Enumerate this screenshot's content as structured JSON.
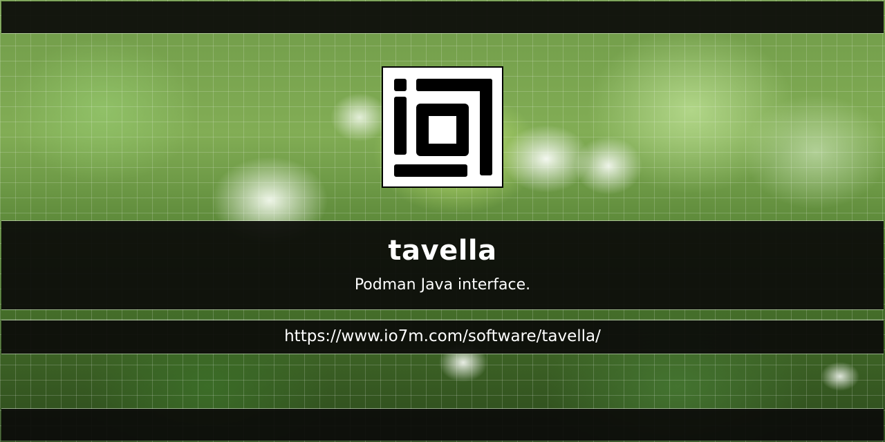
{
  "project": {
    "name": "tavella",
    "description": "Podman Java interface.",
    "url": "https://www.io7m.com/software/tavella/"
  },
  "logo": {
    "icon": "io7m-logo-icon"
  },
  "colors": {
    "bar_background": "#0c0c0a",
    "text": "#ffffff",
    "logo_background": "#ffffff",
    "logo_foreground": "#000000"
  }
}
